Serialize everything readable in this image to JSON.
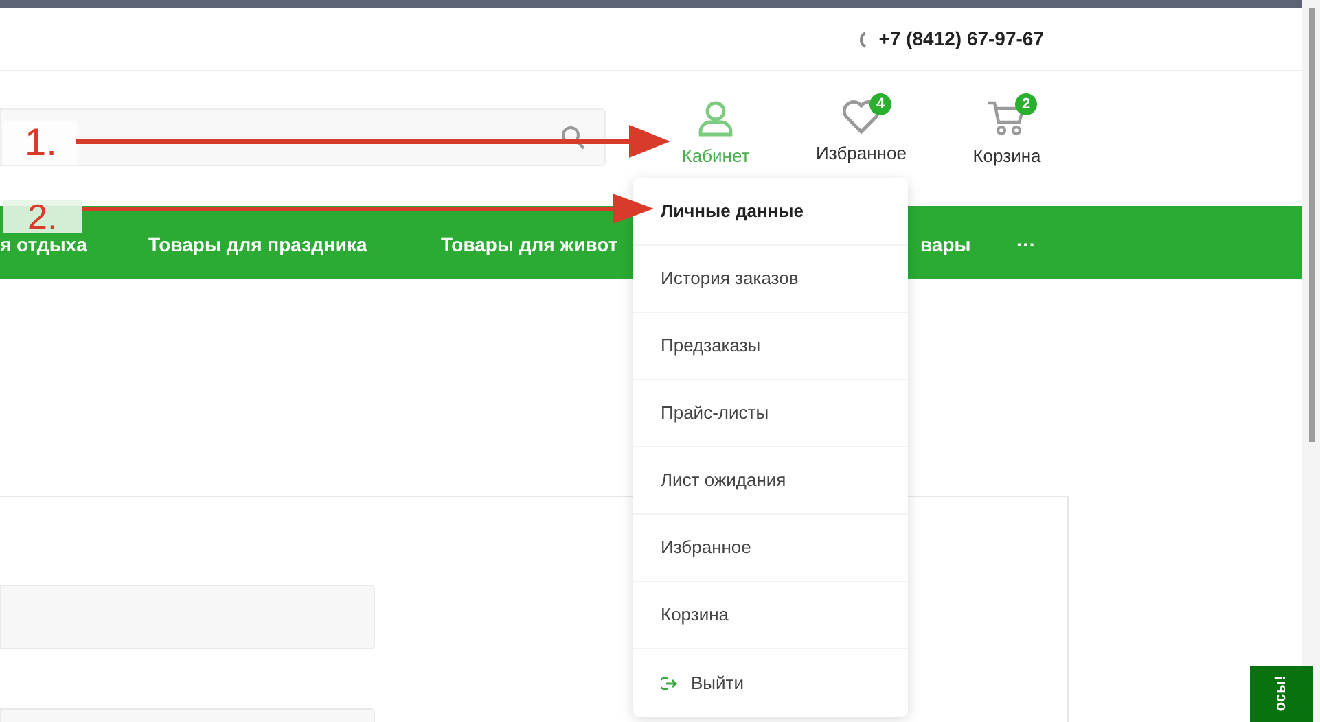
{
  "header": {
    "phone": "+7 (8412) 67-97-67"
  },
  "user_actions": [
    {
      "kind": "account",
      "label": "Кабинет",
      "selected": true
    },
    {
      "kind": "favorites",
      "label": "Избранное",
      "badge": "4",
      "selected": false
    },
    {
      "kind": "cart",
      "label": "Корзина",
      "badge": "2",
      "selected": false
    }
  ],
  "nav": {
    "items": [
      "я отдыха",
      "Товары для праздника",
      "Товары для живот",
      "вары",
      "···"
    ]
  },
  "account_menu": {
    "items": [
      {
        "kind": "link",
        "label": "Личные данные",
        "selected": true
      },
      {
        "kind": "link",
        "label": "История заказов",
        "selected": false
      },
      {
        "kind": "link",
        "label": "Предзаказы",
        "selected": false
      },
      {
        "kind": "link",
        "label": "Прайс-листы",
        "selected": false
      },
      {
        "kind": "link",
        "label": "Лист ожидания",
        "selected": false
      },
      {
        "kind": "link",
        "label": "Избранное",
        "selected": false
      },
      {
        "kind": "link",
        "label": "Корзина",
        "selected": false
      },
      {
        "kind": "logout",
        "label": "Выйти",
        "selected": false
      }
    ]
  },
  "annotations": [
    {
      "label": "1."
    },
    {
      "label": "2."
    }
  ],
  "side_tab": {
    "label": "осы!"
  }
}
